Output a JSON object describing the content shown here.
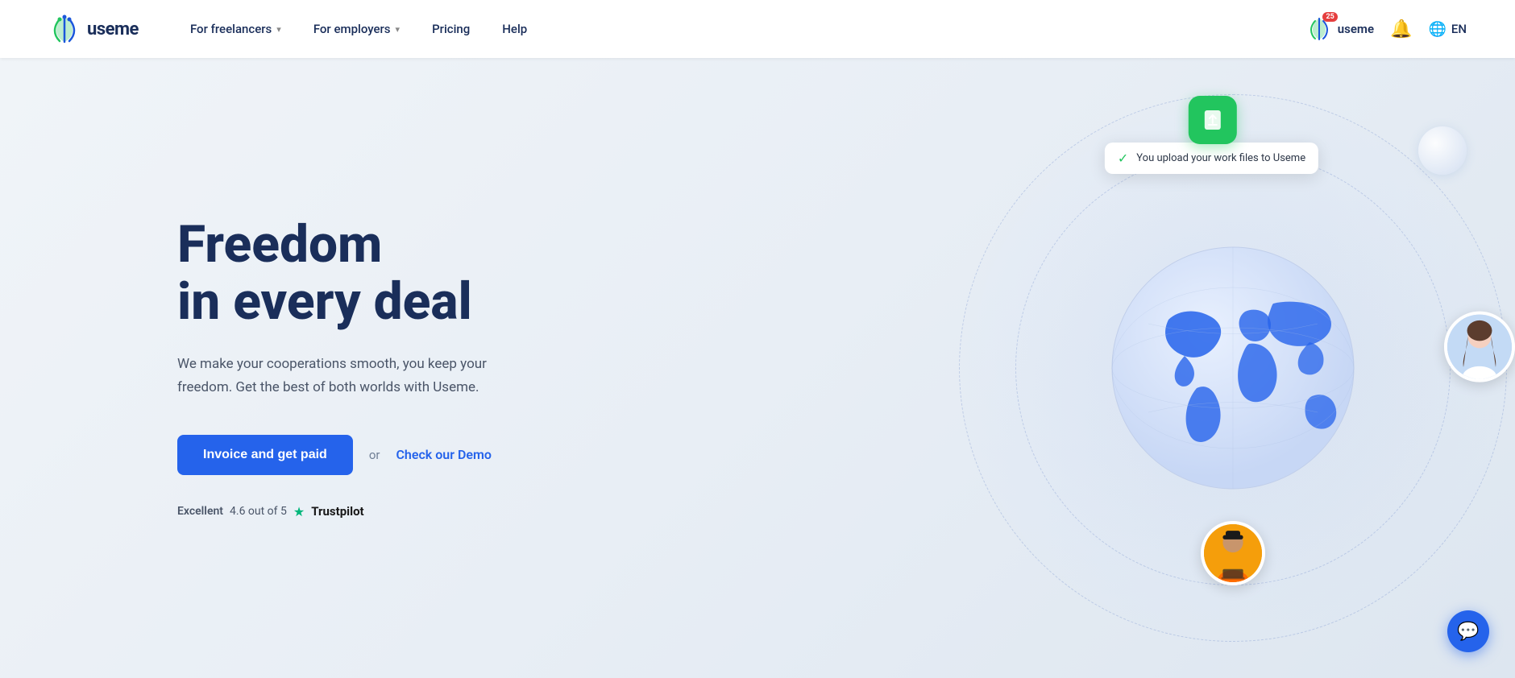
{
  "logo": {
    "text": "useme",
    "alt": "Useme logo"
  },
  "nav": {
    "freelancers_label": "For freelancers",
    "employers_label": "For employers",
    "pricing_label": "Pricing",
    "help_label": "Help",
    "account_label": "useme",
    "notifications_badge": "25",
    "bell_badge": "0",
    "lang_label": "EN"
  },
  "hero": {
    "title_line1": "Freedom",
    "title_line2": "in every deal",
    "subtitle": "We make your cooperations smooth, you keep your freedom. Get the best of both worlds with Useme.",
    "cta_primary": "Invoice and get paid",
    "cta_or": "or",
    "cta_demo": "Check our Demo",
    "trust_label": "Excellent",
    "trust_rating": "4.6 out of 5",
    "trust_platform": "Trustpilot"
  },
  "upload_card": {
    "text": "You upload your work files to Useme"
  },
  "globe": {
    "fill_color": "#2563eb",
    "light_color": "#e8f0fe"
  }
}
